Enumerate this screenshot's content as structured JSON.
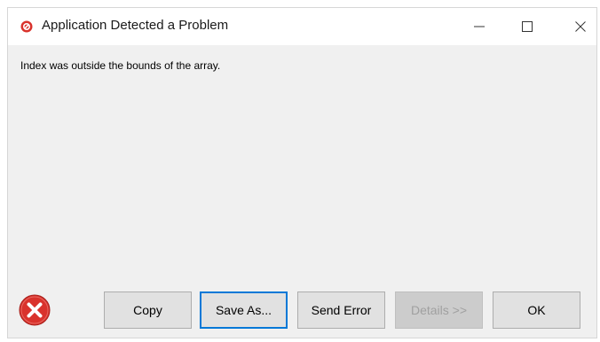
{
  "window": {
    "title": "Application Detected a Problem"
  },
  "message": "Index was outside the bounds of the array.",
  "buttons": {
    "copy": "Copy",
    "save_as": "Save As...",
    "send_error": "Send Error",
    "details": "Details >>",
    "ok": "OK"
  },
  "colors": {
    "error_red": "#d9322c",
    "focus_border": "#0078d7"
  },
  "icons": {
    "title": "error-stop-icon",
    "dialog": "error-icon"
  }
}
